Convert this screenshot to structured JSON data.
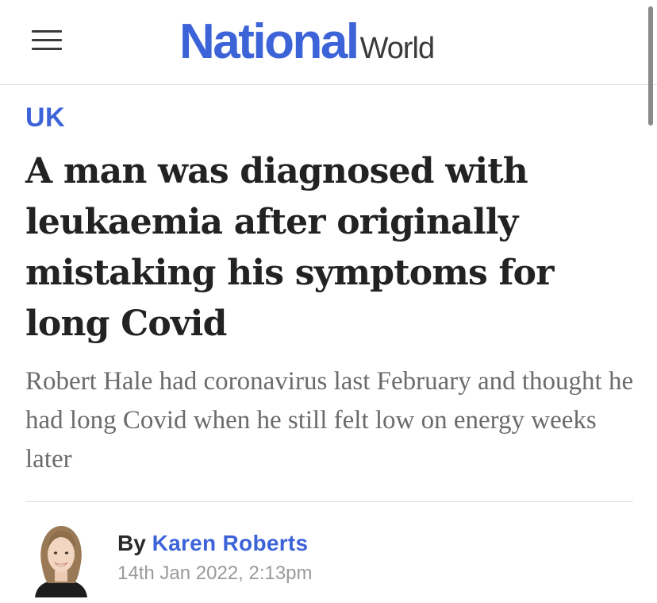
{
  "header": {
    "menu_icon": "hamburger-menu-icon",
    "logo": {
      "primary": "National",
      "secondary": "World"
    }
  },
  "article": {
    "section": "UK",
    "headline": "A man was diagnosed with leukaemia after originally mistaking his symptoms for long Covid",
    "standfirst": "Robert Hale had coronavirus last February and thought he had long Covid when he still felt low on energy weeks later",
    "byline": {
      "prefix": "By",
      "author": "Karen Roberts",
      "timestamp": "14th Jan 2022, 2:13pm"
    }
  },
  "colors": {
    "brand_blue": "#3d63d8",
    "text_dark": "#222222",
    "text_muted": "#6b6b6b",
    "timestamp_grey": "#9a9a9a"
  }
}
